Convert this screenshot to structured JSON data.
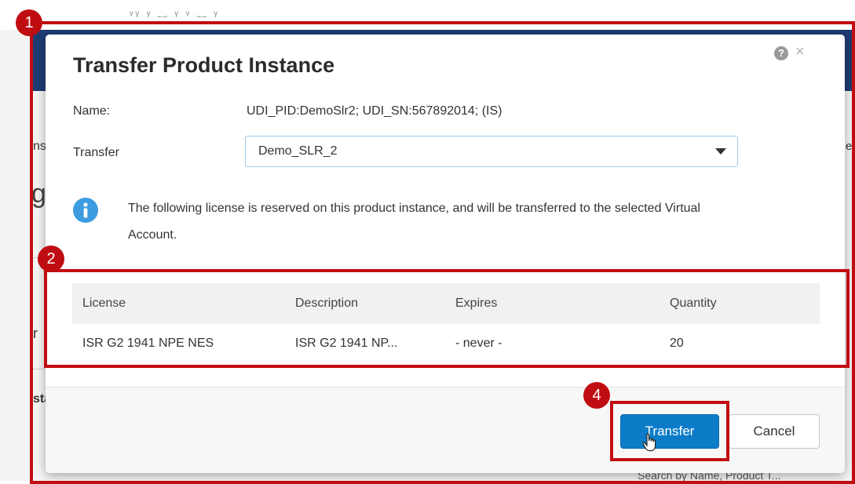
{
  "background": {
    "left_slivers": [
      "ns",
      "g",
      "r",
      "sta"
    ],
    "right_sliver": "el",
    "bottom_text": "Search by Name, Product T..."
  },
  "annotations": {
    "badge_1": "1",
    "badge_2": "2",
    "badge_4": "4"
  },
  "dialog": {
    "title": "Transfer Product Instance",
    "help_icon": "?",
    "close_icon": "×",
    "name_label": "Name:",
    "name_value": "UDI_PID:DemoSlr2; UDI_SN:567892014; (IS)",
    "transfer_label": "Transfer",
    "transfer_selected": "Demo_SLR_2",
    "info_message": "The following license is reserved on this product instance, and will be transferred to the selected Virtual Account.",
    "table": {
      "headers": [
        "License",
        "Description",
        "Expires",
        "Quantity"
      ],
      "rows": [
        [
          "ISR G2 1941 NPE NES",
          "ISR G2 1941 NP...",
          "- never -",
          "20"
        ]
      ]
    },
    "buttons": {
      "transfer": "Transfer",
      "cancel": "Cancel"
    }
  },
  "colors": {
    "annotation_red": "#c00d12",
    "primary_button": "#0d7cc8",
    "info_icon": "#3d9be0",
    "navbar": "#1f3d73"
  }
}
